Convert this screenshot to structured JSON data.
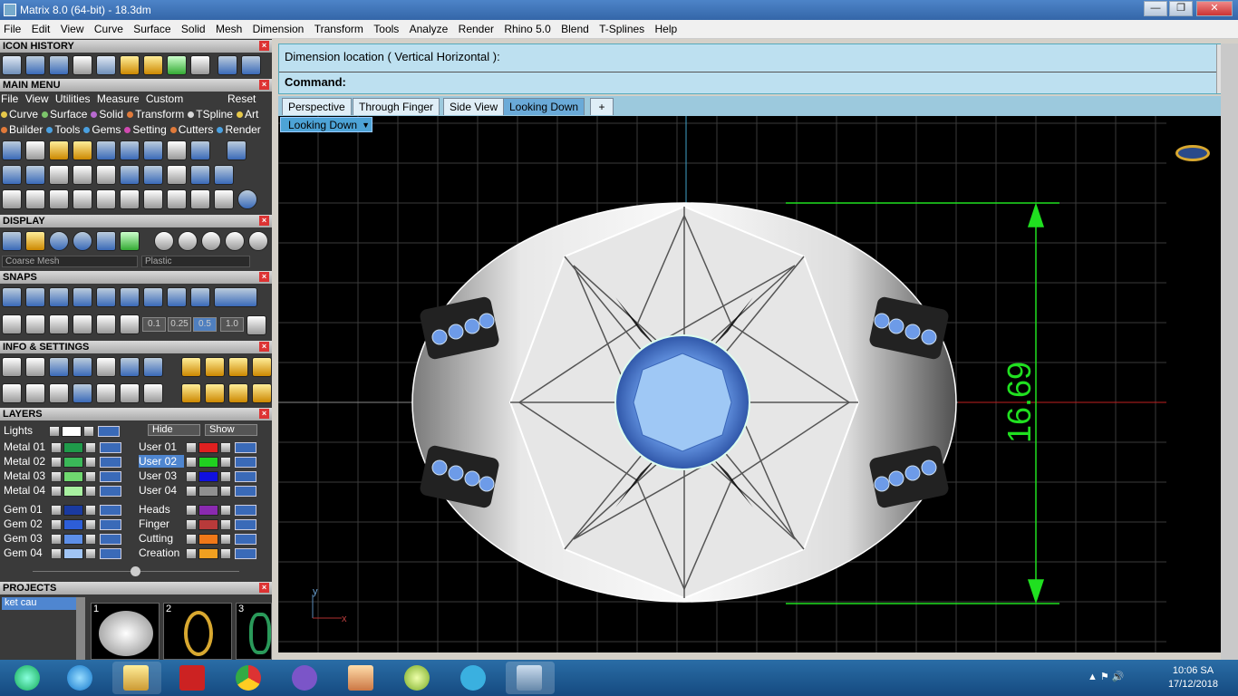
{
  "window": {
    "title": "Matrix 8.0 (64-bit) - 18.3dm",
    "min_label": "—",
    "max_label": "❐",
    "close_label": "✕"
  },
  "menubar": [
    "File",
    "Edit",
    "View",
    "Curve",
    "Surface",
    "Solid",
    "Mesh",
    "Dimension",
    "Transform",
    "Tools",
    "Analyze",
    "Render",
    "Rhino 5.0",
    "Blend",
    "T-Splines",
    "Help"
  ],
  "panels": {
    "icon_history": "ICON HISTORY",
    "main_menu": "MAIN MENU",
    "display": "DISPLAY",
    "snaps": "SNAPS",
    "info_settings": "INFO & SETTINGS",
    "layers": "LAYERS",
    "projects": "PROJECTS"
  },
  "main_menu": {
    "row1": [
      "File",
      "View",
      "Utilities",
      "Measure",
      "Custom"
    ],
    "reset": "Reset",
    "row2": [
      {
        "label": "Curve",
        "color": "#e6c84a"
      },
      {
        "label": "Surface",
        "color": "#7cc46a"
      },
      {
        "label": "Solid",
        "color": "#b86ad0"
      },
      {
        "label": "Transform",
        "color": "#e07a3a"
      },
      {
        "label": "TSpline",
        "color": "#d8d8d8"
      },
      {
        "label": "Art",
        "color": "#e6c84a"
      }
    ],
    "row3": [
      {
        "label": "Builder",
        "color": "#e07a3a"
      },
      {
        "label": "Tools",
        "color": "#4aa0e0"
      },
      {
        "label": "Gems",
        "color": "#4aa0e0"
      },
      {
        "label": "Setting",
        "color": "#d04ab0"
      },
      {
        "label": "Cutters",
        "color": "#e07a3a"
      },
      {
        "label": "Render",
        "color": "#4aa0e0"
      }
    ]
  },
  "display": {
    "mesh_option": "Coarse Mesh",
    "material_option": "Plastic"
  },
  "snaps": {
    "values": [
      "0.1",
      "0.25",
      "0.5",
      "1.0"
    ]
  },
  "layers": {
    "lights": "Lights",
    "hide": "Hide",
    "show": "Show",
    "left": [
      {
        "name": "Metal 01",
        "color": "#1f9a4a"
      },
      {
        "name": "Metal 02",
        "color": "#3ab858"
      },
      {
        "name": "Metal 03",
        "color": "#6fd86f"
      },
      {
        "name": "Metal 04",
        "color": "#a8f0a0"
      },
      {
        "name": "Gem 01",
        "color": "#1a3aa0"
      },
      {
        "name": "Gem 02",
        "color": "#2d5ed8"
      },
      {
        "name": "Gem 03",
        "color": "#5d8fe8"
      },
      {
        "name": "Gem 04",
        "color": "#a0c4f4"
      }
    ],
    "right": [
      {
        "name": "User 01",
        "color": "#e02020"
      },
      {
        "name": "User 02",
        "color": "#20d020"
      },
      {
        "name": "User 03",
        "color": "#1010e0"
      },
      {
        "name": "User 04",
        "color": "#909090"
      },
      {
        "name": "Heads",
        "color": "#8a2ab0"
      },
      {
        "name": "Finger",
        "color": "#b83a3a"
      },
      {
        "name": "Cutting",
        "color": "#f07818"
      },
      {
        "name": "Creation",
        "color": "#f0a020"
      }
    ]
  },
  "projects": {
    "item": "ket cau",
    "thumbs": [
      "1",
      "2",
      "3"
    ]
  },
  "command": {
    "prompt": "Dimension location ( Vertical  Horizontal ):",
    "label": "Command:"
  },
  "tabs": [
    "Perspective",
    "Through Finger",
    "Side View",
    "Looking Down"
  ],
  "active_tab": "Looking Down",
  "add_tab": "+",
  "viewport": {
    "view_name": "Looking Down",
    "dimension": "16.69",
    "axis_y": "y",
    "axis_x": "x"
  },
  "taskbar": {
    "time": "10:06 SA",
    "date": "17/12/2018"
  }
}
